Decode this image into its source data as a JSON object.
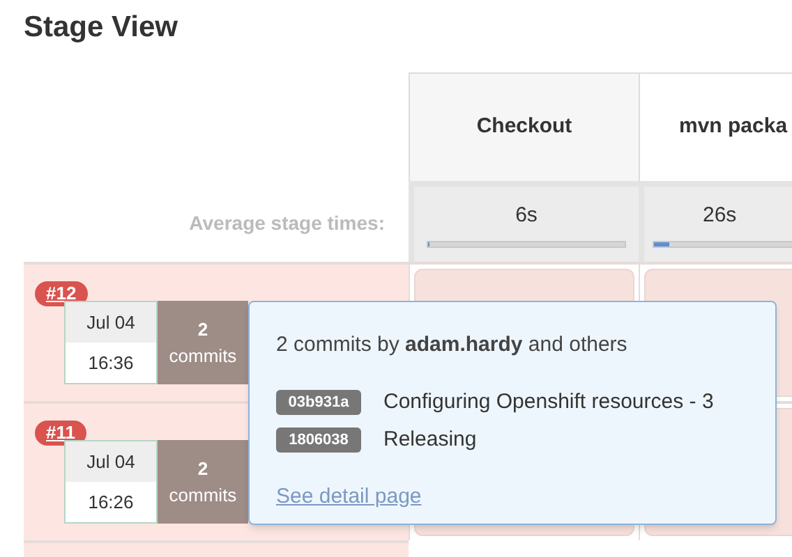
{
  "title": "Stage View",
  "stages": [
    {
      "name": "Checkout",
      "avg": "6s",
      "level": 0.01
    },
    {
      "name": "mvn packa",
      "avg": "26s",
      "level": 0.08
    }
  ],
  "average_label": "Average stage times:",
  "builds": [
    {
      "number": "#12",
      "date": "Jul 04",
      "time": "16:36",
      "commits_count": "2",
      "commits_label": "commits"
    },
    {
      "number": "#11",
      "date": "Jul 04",
      "time": "16:26",
      "commits_count": "2",
      "commits_label": "commits"
    }
  ],
  "popover": {
    "summary": "2 commits by **adam.hardy** and others",
    "commits": [
      {
        "hash": "03b931a",
        "message": "Configuring Openshift resources - 3"
      },
      {
        "hash": "1806038",
        "message": "Releasing"
      }
    ],
    "link": "See detail page"
  }
}
